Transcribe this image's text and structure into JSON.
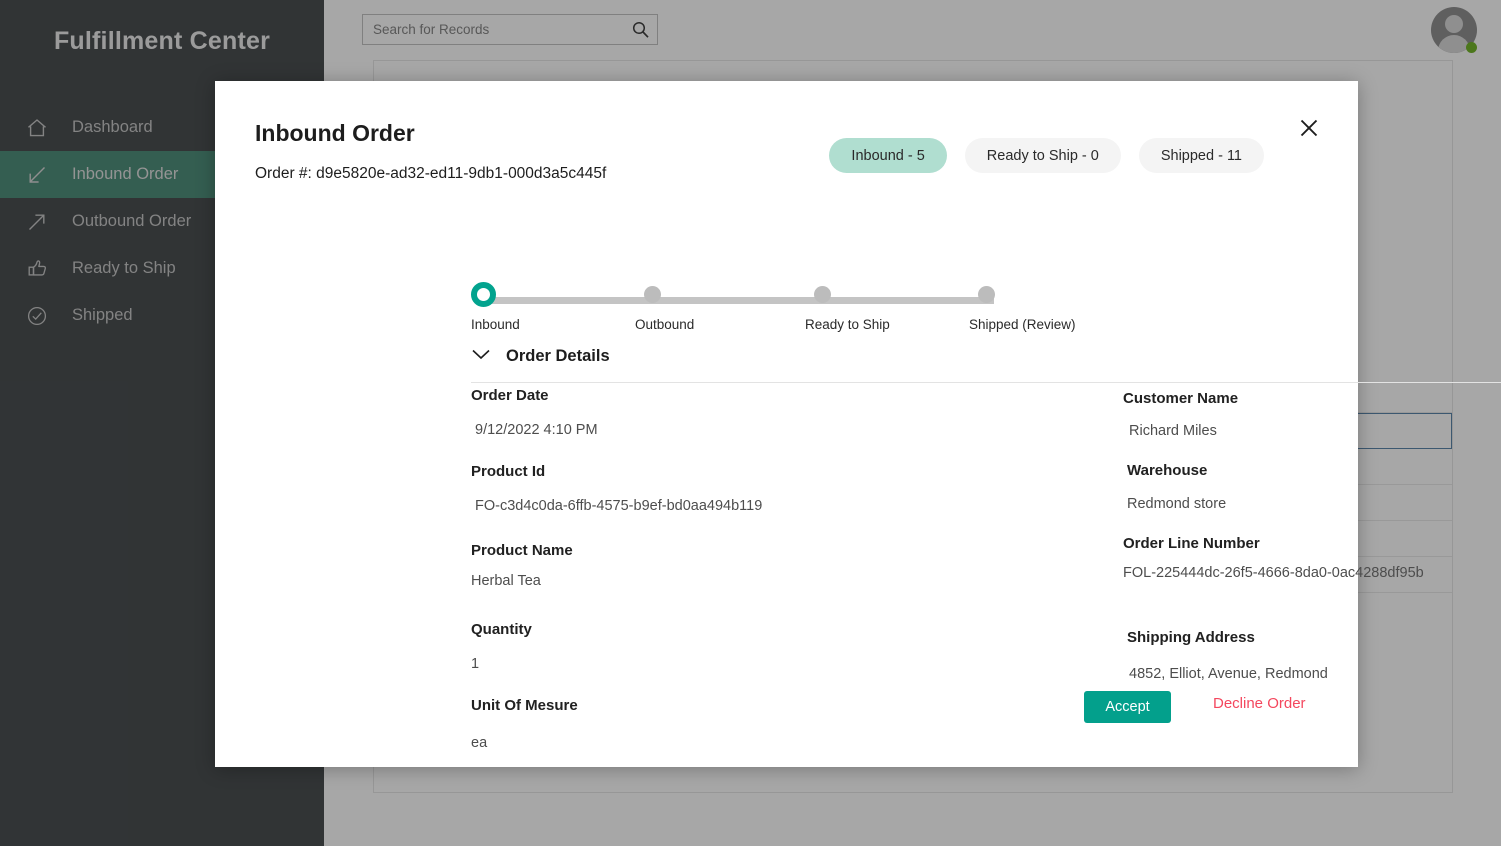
{
  "sidebar": {
    "brand": "Fulfillment Center",
    "items": [
      {
        "label": "Dashboard",
        "icon": "home-icon",
        "active": false
      },
      {
        "label": "Inbound Order",
        "icon": "arrow-down-left-icon",
        "active": true
      },
      {
        "label": "Outbound Order",
        "icon": "arrow-up-right-icon",
        "active": false
      },
      {
        "label": "Ready to Ship",
        "icon": "thumbs-up-icon",
        "active": false
      },
      {
        "label": "Shipped",
        "icon": "check-circle-icon",
        "active": false
      }
    ],
    "active_color": "#2f7a63",
    "background_color": "#282e31"
  },
  "topbar": {
    "search_placeholder": "Search for Records",
    "search_value": "",
    "search_icon": "magnifier-icon",
    "avatar_icon": "user-avatar-icon",
    "presence_color": "#5aa802"
  },
  "modal": {
    "title": "Inbound Order",
    "order_number_label": "Order #: d9e5820e-ad32-ed11-9db1-000d3a5c445f",
    "close_icon": "close-icon",
    "pills": [
      {
        "label": "Inbound - 5",
        "active": true
      },
      {
        "label": "Ready to Ship - 0",
        "active": false
      },
      {
        "label": "Shipped - 11",
        "active": false
      }
    ],
    "stepper": {
      "steps": [
        {
          "label": "Inbound",
          "active": true
        },
        {
          "label": "Outbound",
          "active": false
        },
        {
          "label": "Ready to Ship",
          "active": false
        },
        {
          "label": "Shipped (Review)",
          "active": false
        }
      ],
      "active_color": "#02a38e",
      "inactive_color": "#bcbcbc"
    },
    "details": {
      "section_label": "Order Details",
      "chevron_icon": "chevron-down-icon",
      "left_fields": [
        {
          "label": "Order Date",
          "value": "9/12/2022 4:10 PM"
        },
        {
          "label": "Product Id",
          "value": "FO-c3d4c0da-6ffb-4575-b9ef-bd0aa494b119"
        },
        {
          "label": "Product Name",
          "value": "Herbal Tea"
        },
        {
          "label": "Quantity",
          "value": "1"
        },
        {
          "label": "Unit Of Mesure",
          "value": "ea"
        }
      ],
      "right_fields": [
        {
          "label": "Customer Name",
          "value": "Richard Miles"
        },
        {
          "label": "Warehouse",
          "value": "Redmond store"
        },
        {
          "label": "Order Line Number",
          "value": "FOL-225444dc-26f5-4666-8da0-0ac4288df95b"
        },
        {
          "label": "Shipping Address",
          "value": "4852, Elliot, Avenue, Redmond"
        }
      ]
    },
    "actions": {
      "accept_label": "Accept",
      "accept_color": "#03a08c",
      "decline_label": "Decline Order",
      "decline_color": "#f4475e"
    }
  }
}
